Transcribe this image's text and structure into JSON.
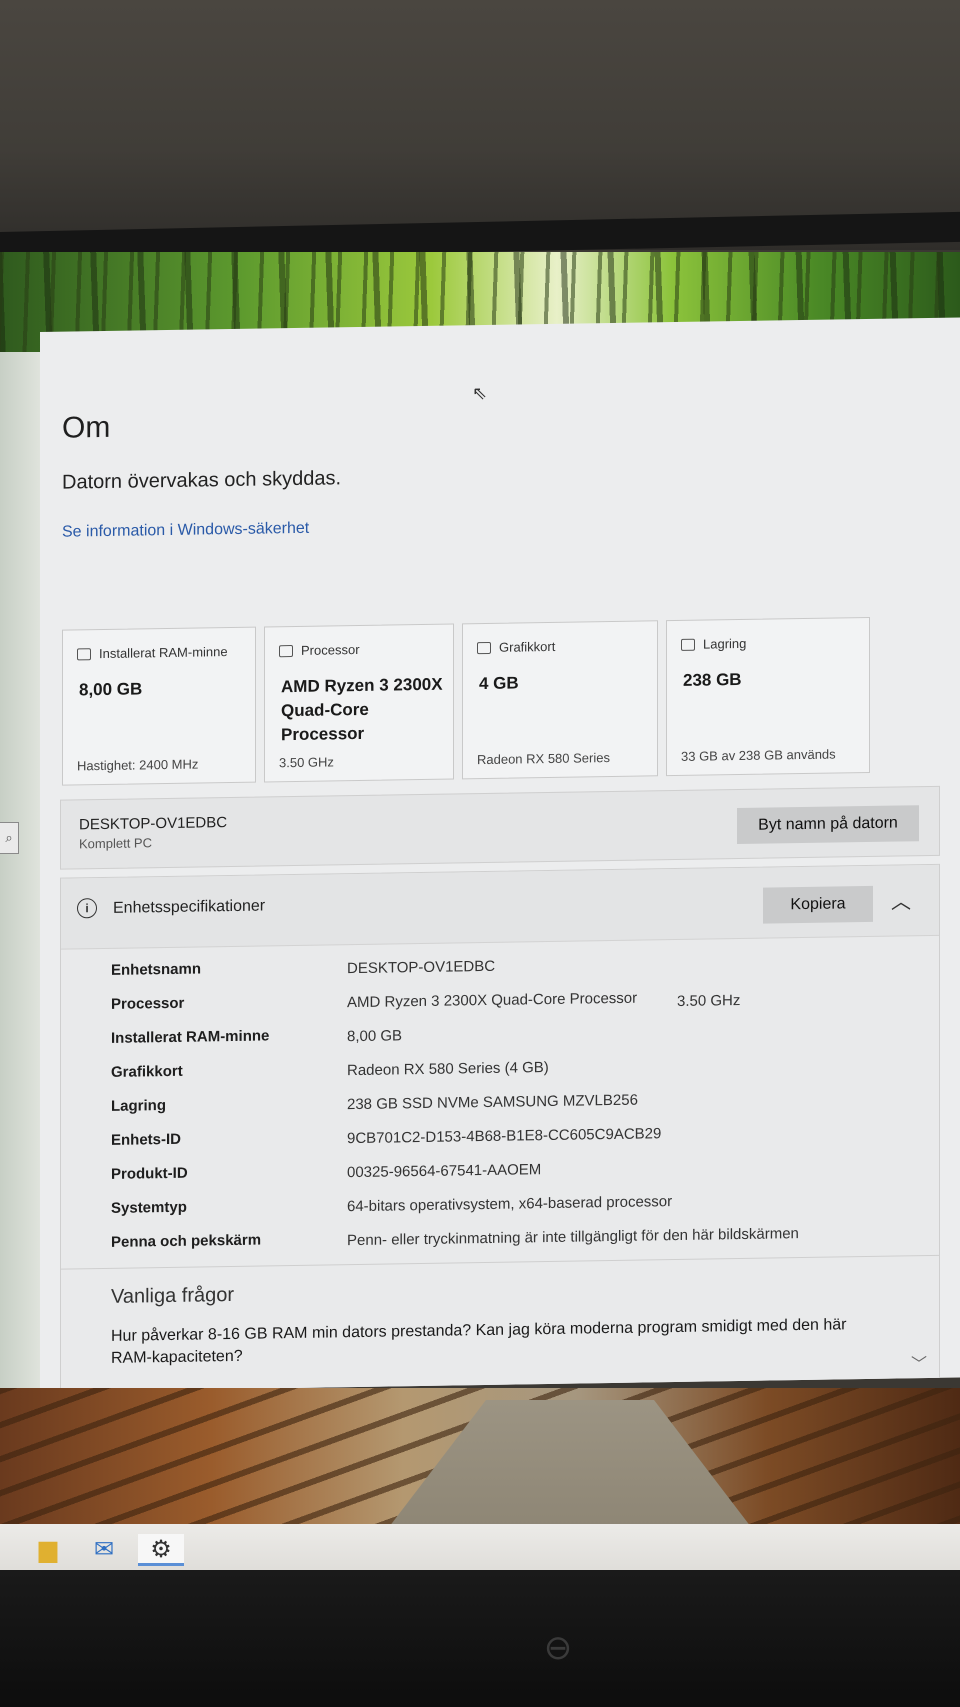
{
  "page": {
    "title": "Om",
    "status": "Datorn övervakas och skyddas.",
    "security_link": "Se information i Windows-säkerhet"
  },
  "cards": [
    {
      "icon": "ram-icon",
      "label": "Installerat RAM-minne",
      "value": "8,00 GB",
      "sub": "Hastighet: 2400 MHz"
    },
    {
      "icon": "processor-icon",
      "label": "Processor",
      "value": "AMD Ryzen 3 2300X Quad-Core Processor",
      "sub": "3.50 GHz"
    },
    {
      "icon": "graphics-card-icon",
      "label": "Grafikkort",
      "value": "4 GB",
      "sub": "Radeon RX 580 Series"
    },
    {
      "icon": "storage-icon",
      "label": "Lagring",
      "value": "238 GB",
      "sub": "33 GB av 238 GB används"
    }
  ],
  "device": {
    "name": "DESKTOP-OV1EDBC",
    "model": "Komplett PC",
    "rename_label": "Byt namn på datorn"
  },
  "specs": {
    "title": "Enhetsspecifikationer",
    "copy_label": "Kopiera",
    "rows": [
      {
        "k": "Enhetsnamn",
        "v": "DESKTOP-OV1EDBC",
        "v2": ""
      },
      {
        "k": "Processor",
        "v": "AMD Ryzen 3 2300X Quad-Core Processor",
        "v2": "3.50 GHz"
      },
      {
        "k": "Installerat RAM-minne",
        "v": "8,00 GB",
        "v2": ""
      },
      {
        "k": "Grafikkort",
        "v": "Radeon RX 580 Series (4 GB)",
        "v2": ""
      },
      {
        "k": "Lagring",
        "v": "238 GB SSD NVMe SAMSUNG MZVLB256",
        "v2": ""
      },
      {
        "k": "Enhets-ID",
        "v": "9CB701C2-D153-4B68-B1E8-CC605C9ACB29",
        "v2": ""
      },
      {
        "k": "Produkt-ID",
        "v": "00325-96564-67541-AAOEM",
        "v2": ""
      },
      {
        "k": "Systemtyp",
        "v": "64-bitars operativsystem, x64-baserad processor",
        "v2": ""
      },
      {
        "k": "Penna och pekskärm",
        "v": "Penn- eller tryckinmatning är inte tillgängligt för den här bildskärmen",
        "v2": ""
      }
    ]
  },
  "faq": {
    "title": "Vanliga frågor",
    "question": "Hur påverkar 8-16 GB RAM min dators prestanda? Kan jag köra moderna program smidigt med den här RAM-kapaciteten?"
  },
  "taskbar": {
    "icons": [
      "file-explorer-icon",
      "mail-icon",
      "settings-icon"
    ]
  }
}
